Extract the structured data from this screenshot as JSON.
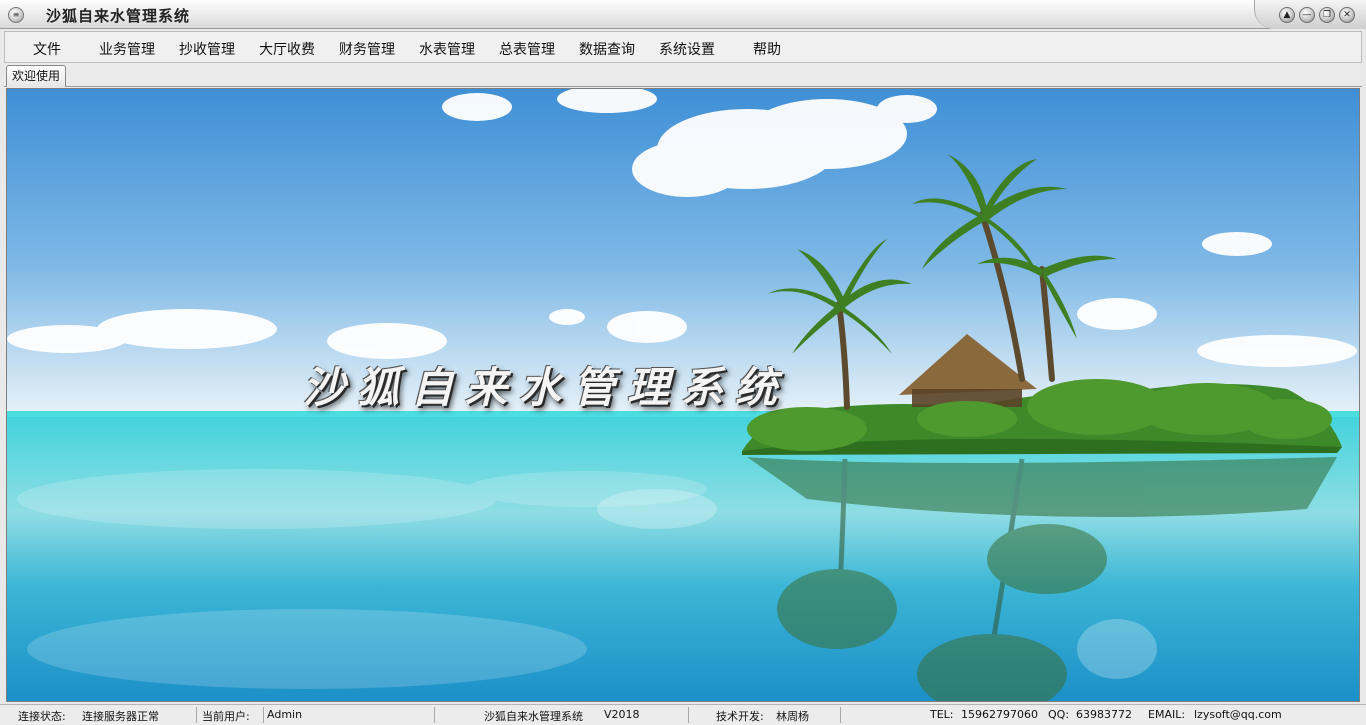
{
  "window": {
    "title": "沙狐自来水管理系统",
    "controls": [
      "help-icon",
      "minimize-icon",
      "restore-icon",
      "close-icon"
    ]
  },
  "menu": {
    "items": [
      "文件",
      "业务管理",
      "抄收管理",
      "大厅收费",
      "财务管理",
      "水表管理",
      "总表管理",
      "数据查询",
      "系统设置",
      "帮助"
    ]
  },
  "tabs": [
    {
      "label": "欢迎使用"
    }
  ],
  "splash": {
    "title": "沙狐自来水管理系统"
  },
  "status": {
    "conn_label": "连接状态:",
    "conn_value": "连接服务器正常",
    "user_label": "当前用户:",
    "user_value": "Admin",
    "app_name": "沙狐自来水管理系统",
    "version": "V2018",
    "dev_label": "技术开发:",
    "dev_value": "林周杨",
    "tel_label": "TEL:",
    "tel_value": "15962797060",
    "qq_label": "QQ:",
    "qq_value": "63983772",
    "email_label": "EMAIL:",
    "email_value": "lzysoft@qq.com"
  },
  "colors": {
    "sky_top": "#3f8fd6",
    "sea": "#2fc3d6",
    "sand": "#e8f6f8"
  }
}
